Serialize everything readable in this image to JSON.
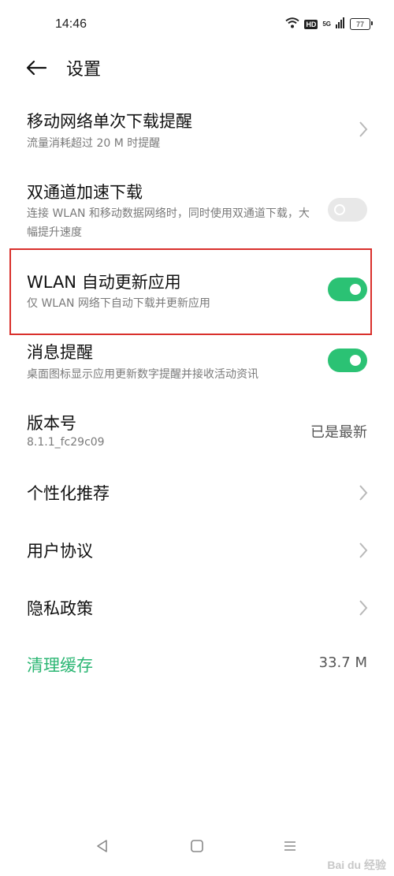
{
  "status_bar": {
    "time": "14:46",
    "hd": "HD",
    "network": "5G",
    "battery": "77"
  },
  "header": {
    "title": "设置"
  },
  "settings": {
    "mobile_download": {
      "title": "移动网络单次下载提醒",
      "subtitle": "流量消耗超过 20 M 时提醒"
    },
    "dual_channel": {
      "title": "双通道加速下载",
      "subtitle": "连接 WLAN 和移动数据网络时，同时使用双通道下载，大幅提升速度",
      "enabled": false
    },
    "wlan_auto_update": {
      "title": "WLAN 自动更新应用",
      "subtitle": "仅 WLAN 网络下自动下载并更新应用",
      "enabled": true
    },
    "notification": {
      "title": "消息提醒",
      "subtitle": "桌面图标显示应用更新数字提醒并接收活动资讯",
      "enabled": true
    },
    "version": {
      "title": "版本号",
      "subtitle": "8.1.1_fc29c09",
      "value": "已是最新"
    },
    "personalized": {
      "title": "个性化推荐"
    },
    "user_agreement": {
      "title": "用户协议"
    },
    "privacy": {
      "title": "隐私政策"
    },
    "clear_cache": {
      "title": "清理缓存",
      "value": "33.7 M"
    }
  },
  "watermark": "Bai du 经验",
  "colors": {
    "accent": "#2bc274",
    "highlight": "#d9302c"
  }
}
